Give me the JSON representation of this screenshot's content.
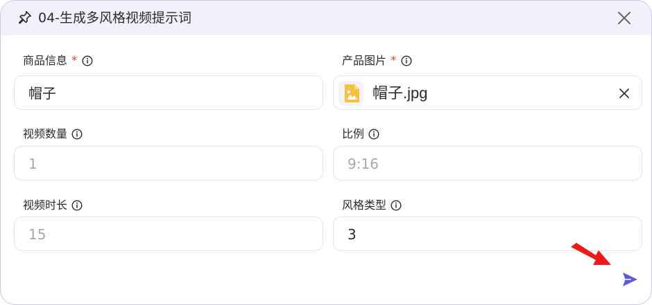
{
  "header": {
    "title": "04-生成多风格视频提示词",
    "icon": "pin-icon",
    "close_icon": "close-icon"
  },
  "fields": {
    "product_info": {
      "label": "商品信息",
      "required_mark": "*",
      "value": "帽子"
    },
    "product_image": {
      "label": "产品图片",
      "required_mark": "*",
      "file_name": "帽子.jpg"
    },
    "video_count": {
      "label": "视频数量",
      "placeholder": "1"
    },
    "ratio": {
      "label": "比例",
      "placeholder": "9:16"
    },
    "video_duration": {
      "label": "视频时长",
      "placeholder": "15"
    },
    "style_type": {
      "label": "风格类型",
      "value": "3"
    }
  },
  "colors": {
    "header_bg": "#f2f1fb",
    "required": "#e0462b",
    "send": "#5b5bd6",
    "annotation_arrow": "#ee1a1a",
    "file_icon": "#f5c342"
  }
}
